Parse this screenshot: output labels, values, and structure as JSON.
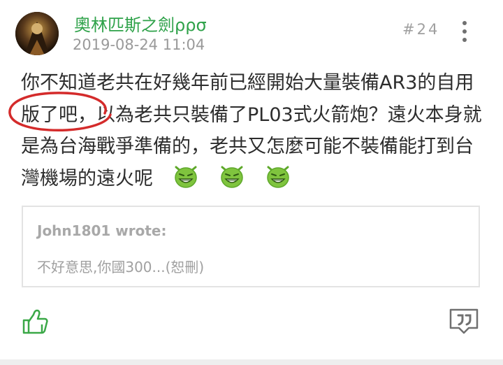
{
  "post": {
    "author": "奧林匹斯之劍ρρσ",
    "timestamp": "2019-08-24 11:04",
    "floor": "#24",
    "body": "你不知道老共在好幾年前已經開始大量裝備AR3的自用版了吧，以為老共只裝備了PL03式火箭炮？遠火本身就是為台海戰爭準備的，老共又怎麼可能不裝備能打到台灣機場的遠火呢",
    "emojis": [
      "grin-emoji",
      "grin-emoji",
      "grin-emoji"
    ]
  },
  "quote": {
    "author": "John1801 wrote:",
    "text": "不好意思,你國300...(恕刪)"
  },
  "actions": {
    "like_icon": "thumbs-up-icon",
    "reply_icon": "quote-reply-icon",
    "more_icon": "more-vertical-icon"
  },
  "colors": {
    "accent": "#2fa24a",
    "annotation": "#d42b2b",
    "muted": "#9a9a9a",
    "emoji": "#7fc43e"
  }
}
